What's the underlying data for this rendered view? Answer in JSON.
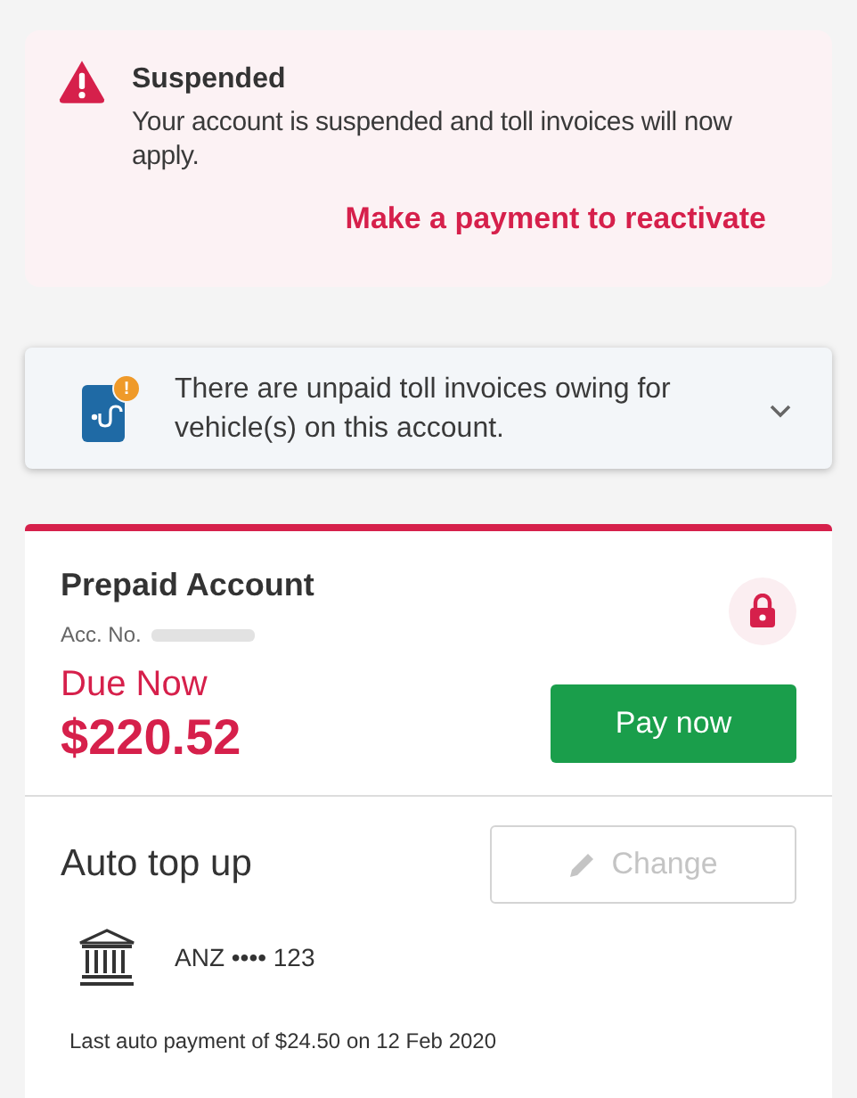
{
  "alert": {
    "title": "Suspended",
    "message": "Your account is suspended and toll invoices will now apply.",
    "link": "Make a payment to reactivate"
  },
  "notice": {
    "text": "There are unpaid toll invoices owing for vehicle(s) on this account.",
    "badge": "!",
    "expanded": false
  },
  "account": {
    "title": "Prepaid Account",
    "number_label": "Acc. No.",
    "locked": true,
    "due_label": "Due Now",
    "amount": "$220.52",
    "pay_button": "Pay now"
  },
  "auto_top_up": {
    "title": "Auto top up",
    "change_button": "Change",
    "change_disabled": true,
    "bank": "ANZ •••• 123",
    "last_payment": "Last auto payment of $24.50 on 12 Feb 2020"
  }
}
